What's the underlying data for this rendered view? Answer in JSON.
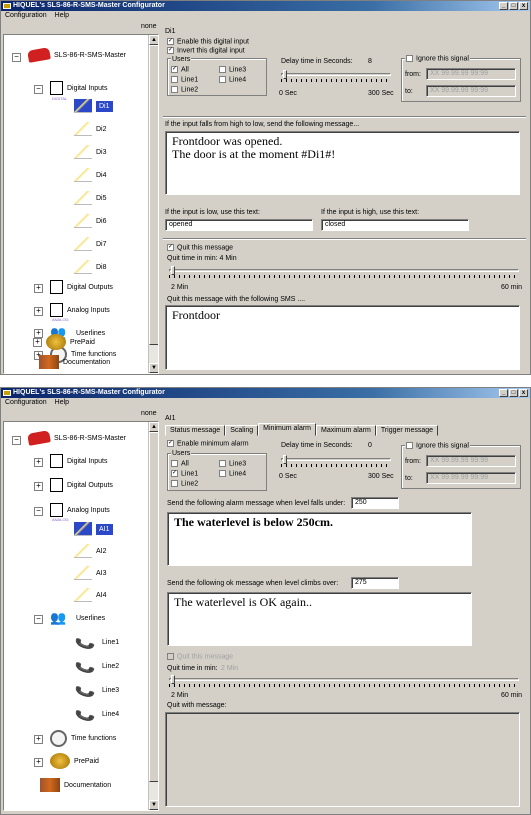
{
  "window1": {
    "title": "HIQUEL's SLS-86-R-SMS-Master Configurator",
    "menu": [
      "Configuration",
      "Help"
    ],
    "tree_header": "none",
    "tree": [
      {
        "label": "SLS-86-R-SMS-Master",
        "icon": "phone-red-icon"
      },
      {
        "label": "Digital Inputs",
        "icon": "document-icon",
        "sub": "DIGITAL"
      },
      {
        "label": "Di1"
      },
      {
        "label": "Di2"
      },
      {
        "label": "Di3"
      },
      {
        "label": "Di4"
      },
      {
        "label": "Di5"
      },
      {
        "label": "Di6"
      },
      {
        "label": "Di7"
      },
      {
        "label": "Di8"
      },
      {
        "label": "Digital Outputs",
        "icon": "document-icon"
      },
      {
        "label": "Analog Inputs",
        "icon": "document-icon",
        "sub": "ANALOG"
      },
      {
        "label": "Userlines",
        "icon": "people-icon"
      },
      {
        "label": "Time functions",
        "icon": "clock-icon"
      },
      {
        "label": "PrePaid",
        "icon": "coins-icon"
      },
      {
        "label": "Documentation",
        "icon": "book-icon"
      }
    ],
    "group_title": "Di1",
    "enable_label": "Enable this digital input",
    "invert_label": "Invert this digital input",
    "users_title": "Users",
    "users": [
      "All",
      "Line3",
      "Line1",
      "Line4",
      "Line2"
    ],
    "delay_label": "Delay time in Seconds:",
    "delay_value": "8",
    "delay_min": "0 Sec",
    "delay_max": "300 Sec",
    "ignore_label": "Ignore this signal",
    "from_label": "from:",
    "to_label": "to:",
    "from_value": "XX 99.99.99 99:99",
    "to_value": "XX 99.99.99 99:99",
    "falls_label": "If the input falls from high to low, send the following message...",
    "message": "Frontdoor was opened.\nThe door is at the moment #Di1#!",
    "low_label": "If the input is low, use this text:",
    "high_label": "If the input is high, use this text:",
    "low_value": "opened",
    "high_value": "closed",
    "quit_label": "Quit this message",
    "quit_time_label": "Quit time in min:  4 Min",
    "quit_min": "2 Min",
    "quit_max": "60 min",
    "quit_sms_label": "Quit this message with the following SMS ....",
    "quit_sms": "Frontdoor"
  },
  "window2": {
    "title": "HIQUEL's SLS-86-R-SMS-Master Configurator",
    "menu": [
      "Configuration",
      "Help"
    ],
    "tree_header": "none",
    "tree": [
      {
        "label": "SLS-86-R-SMS-Master"
      },
      {
        "label": "Digital Inputs"
      },
      {
        "label": "Digital Outputs"
      },
      {
        "label": "Analog Inputs",
        "sub": "ANALOG"
      },
      {
        "label": "AI1"
      },
      {
        "label": "AI2"
      },
      {
        "label": "AI3"
      },
      {
        "label": "AI4"
      },
      {
        "label": "Userlines"
      },
      {
        "label": "Line1"
      },
      {
        "label": "Line2"
      },
      {
        "label": "Line3"
      },
      {
        "label": "Line4"
      },
      {
        "label": "Time functions"
      },
      {
        "label": "PrePaid"
      },
      {
        "label": "Documentation"
      }
    ],
    "group_title": "AI1",
    "tabs": [
      "Status message",
      "Scaling",
      "Minimum alarm",
      "Maximum alarm",
      "Trigger message"
    ],
    "enable_label": "Enable minimum alarm",
    "users_title": "Users",
    "users": [
      "All",
      "Line3",
      "Line1",
      "Line4",
      "Line2"
    ],
    "delay_label": "Delay time in Seconds:",
    "delay_value": "0",
    "delay_min": "0 Sec",
    "delay_max": "300 Sec",
    "ignore_label": "Ignore this signal",
    "from_label": "from:",
    "to_label": "to:",
    "from_value": "XX 99.99.99 99:99",
    "to_value": "XX 99.99.99 99:99",
    "alarm_label": "Send the following alarm message when level falls under:",
    "alarm_level": "250",
    "alarm_message": "The waterlevel is below 250cm.",
    "ok_label": "Send the following ok message when level climbs over:",
    "ok_level": "275",
    "ok_message": "The waterlevel is OK again..",
    "quit_label": "Quit this message",
    "quit_time_label": "Quit time in min:",
    "quit_time_value": "2 Min",
    "quit_min": "2 Min",
    "quit_max": "60 min",
    "quit_with_label": "Quit with message:"
  },
  "colors": {
    "titlebar": "#0a246a",
    "face": "#d4d0c8",
    "selection": "#2b48c8"
  }
}
